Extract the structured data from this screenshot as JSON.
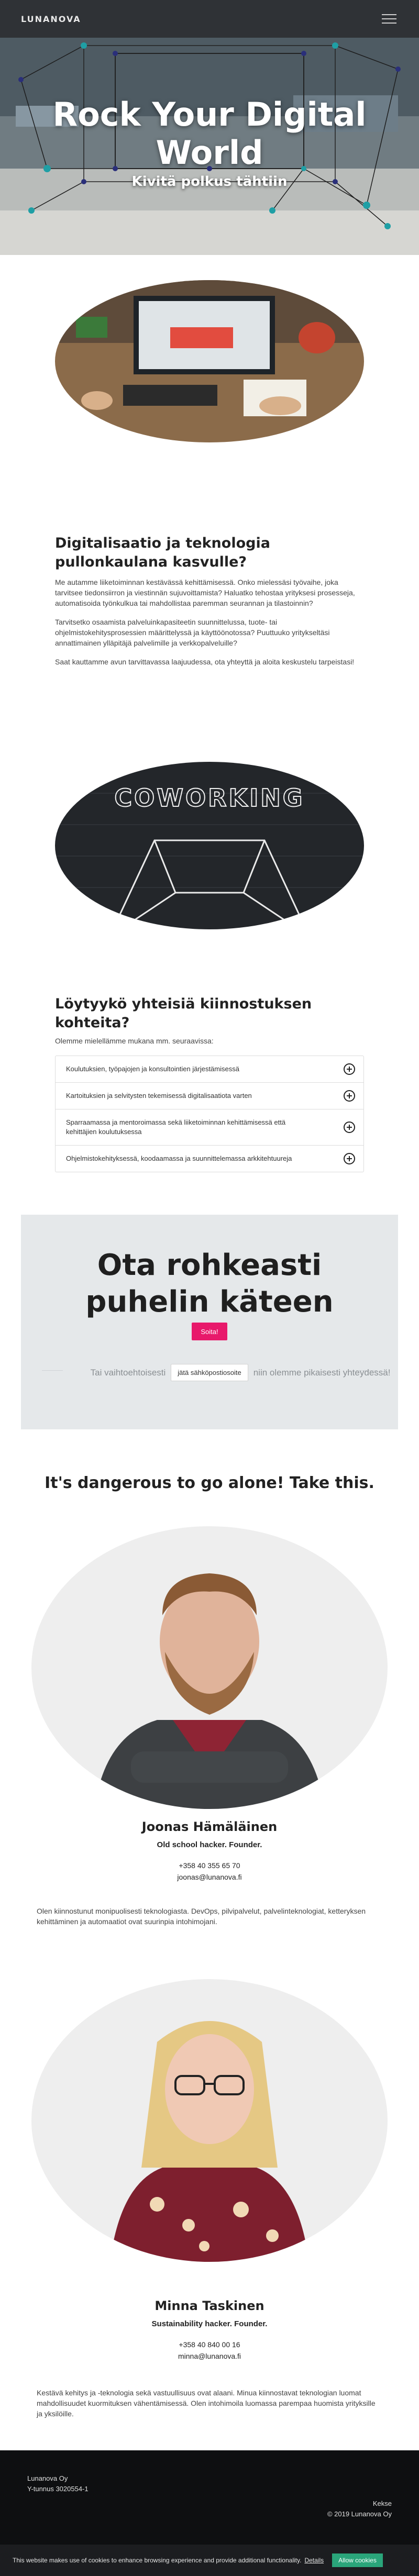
{
  "nav": {
    "brand": "LUNANOVA",
    "menu_icon": "hamburger-menu-icon"
  },
  "hero": {
    "title": "Rock Your Digital World",
    "subtitle": "Kivitä polkus tähtiin"
  },
  "intro": {
    "heading": "Digitalisaatio ja teknologia pullonkaulana kasvulle?",
    "paragraphs": [
      "Me autamme liiketoiminnan kestävässä kehittämisessä. Onko mielessäsi työvaihe, joka tarvitsee tiedonsiirron ja viestinnän sujuvoittamista? Haluatko tehostaa yrityksesi prosesseja, automatisoida työnkulkua tai mahdollistaa paremman seurannan ja tilastoinnin?",
      "Tarvitsetko osaamista palveluinkapasiteetin suunnittelussa, tuote- tai ohjelmistokehitysprosessien määrittelyssä ja käyttöönotossa? Puuttuuko yritykseltäsi annattimainen ylläpitäjä palvelimille ja verkkopalveluille?",
      "Saat kauttamme avun tarvittavassa laajuudessa, ota yhteyttä ja aloita keskustelu tarpeistasi!"
    ]
  },
  "coworking": {
    "sign": "COWORKING"
  },
  "interests": {
    "heading": "Löytyykö yhteisiä kiinnostuksen kohteita?",
    "lead": "Olemme mielellämme mukana mm. seuraavissa:",
    "items": [
      "Koulutuksien, työpajojen ja konsultointien järjestämisessä",
      "Kartoituksien ja selvitysten tekemisessä digitalisaatiota varten",
      "Sparraamassa ja mentoroimassa sekä liiketoiminnan kehittämisessä että kehittäjien koulutuksessa",
      "Ohjelmistokehityksessä, koodaamassa ja suunnittelemassa arkkitehtuureja"
    ]
  },
  "call": {
    "title": "Ota rohkeasti puhelin käteen",
    "button": "Soita!",
    "alt_left": "Tai vaihtoehtoisesti",
    "mail_button": "jätä sähköpostiosoite",
    "alt_right": "niin olemme pikaisesti yhteydessä!"
  },
  "team": {
    "heading": "It's dangerous to go alone! Take this.",
    "members": [
      {
        "name": "Joonas Hämäläinen",
        "role": "Old school hacker. Founder.",
        "phone": "+358 40 355 65 70",
        "email": "joonas@lunanova.fi",
        "bio": "Olen kiinnostunut monipuolisesti teknologiasta. DevOps, pilvipalvelut, palvelinteknologiat, ketteryksen kehittäminen ja automaatiot ovat suurinpia intohimojani."
      },
      {
        "name": "Minna Taskinen",
        "role": "Sustainability hacker. Founder.",
        "phone": "+358 40 840 00 16",
        "email": "minna@lunanova.fi",
        "bio": "Kestävä kehitys ja -teknologia sekä vastuullisuus ovat alaani. Minua kiinnostavat teknologian luomat mahdollisuudet kuormituksen vähentämisessä. Olen intohimoila luomassa parempaa huomista yrityksille ja yksilöille."
      }
    ]
  },
  "footer": {
    "company": "Lunanova Oy",
    "business_id": "Y-tunnus 3020554-1",
    "links": "Kekse",
    "copyright": "© 2019 Lunanova Oy"
  },
  "cookie": {
    "text": "This website makes use of cookies to enhance browsing experience and provide additional functionality.",
    "details_link": "Details",
    "button": "Allow cookies"
  },
  "colors": {
    "accent": "#e8196b",
    "navbar": "#2f3236",
    "callbox": "#e5e8ea",
    "cookie_button": "#2aa57a"
  }
}
